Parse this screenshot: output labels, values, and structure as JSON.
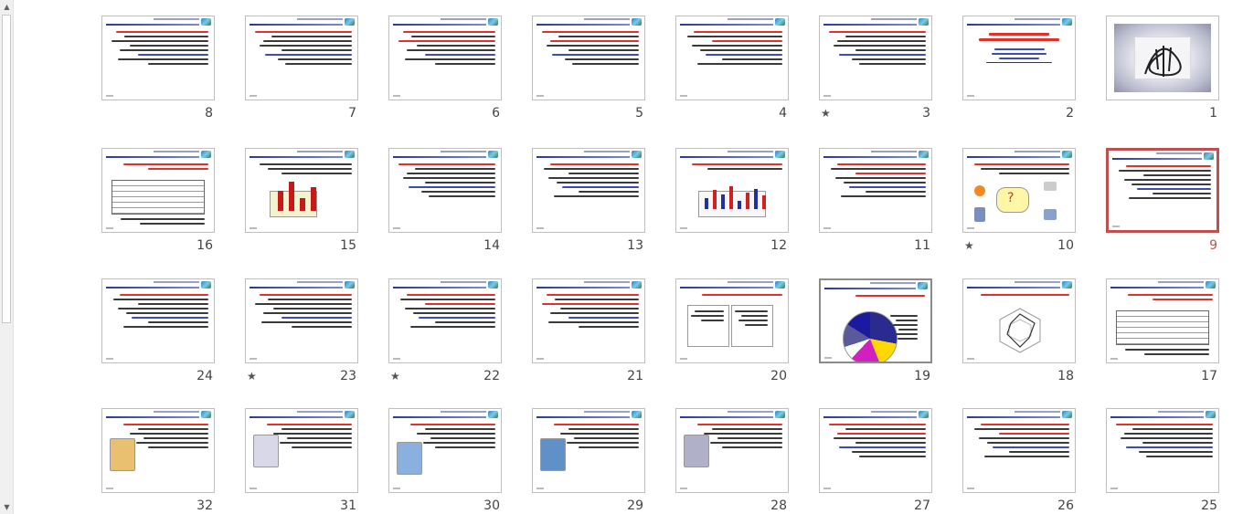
{
  "slides": [
    {
      "num": "1",
      "star": false,
      "selected": false,
      "hovered": false,
      "kind": "calligraphy"
    },
    {
      "num": "2",
      "star": false,
      "selected": false,
      "hovered": false,
      "kind": "title"
    },
    {
      "num": "3",
      "star": true,
      "selected": false,
      "hovered": false,
      "kind": "text"
    },
    {
      "num": "4",
      "star": false,
      "selected": false,
      "hovered": false,
      "kind": "text"
    },
    {
      "num": "5",
      "star": false,
      "selected": false,
      "hovered": false,
      "kind": "text"
    },
    {
      "num": "6",
      "star": false,
      "selected": false,
      "hovered": false,
      "kind": "text"
    },
    {
      "num": "7",
      "star": false,
      "selected": false,
      "hovered": false,
      "kind": "text"
    },
    {
      "num": "8",
      "star": false,
      "selected": false,
      "hovered": false,
      "kind": "text"
    },
    {
      "num": "9",
      "star": false,
      "selected": true,
      "hovered": false,
      "kind": "text"
    },
    {
      "num": "10",
      "star": true,
      "selected": false,
      "hovered": false,
      "kind": "diagram"
    },
    {
      "num": "11",
      "star": false,
      "selected": false,
      "hovered": false,
      "kind": "text"
    },
    {
      "num": "12",
      "star": false,
      "selected": false,
      "hovered": false,
      "kind": "barchart"
    },
    {
      "num": "13",
      "star": false,
      "selected": false,
      "hovered": false,
      "kind": "text"
    },
    {
      "num": "14",
      "star": false,
      "selected": false,
      "hovered": false,
      "kind": "text"
    },
    {
      "num": "15",
      "star": false,
      "selected": false,
      "hovered": false,
      "kind": "barchart3d"
    },
    {
      "num": "16",
      "star": false,
      "selected": false,
      "hovered": false,
      "kind": "table"
    },
    {
      "num": "17",
      "star": false,
      "selected": false,
      "hovered": false,
      "kind": "table"
    },
    {
      "num": "18",
      "star": false,
      "selected": false,
      "hovered": false,
      "kind": "radar"
    },
    {
      "num": "19",
      "star": false,
      "selected": false,
      "hovered": true,
      "kind": "pie"
    },
    {
      "num": "20",
      "star": false,
      "selected": false,
      "hovered": false,
      "kind": "boxes"
    },
    {
      "num": "21",
      "star": false,
      "selected": false,
      "hovered": false,
      "kind": "text"
    },
    {
      "num": "22",
      "star": true,
      "selected": false,
      "hovered": false,
      "kind": "text"
    },
    {
      "num": "23",
      "star": true,
      "selected": false,
      "hovered": false,
      "kind": "text"
    },
    {
      "num": "24",
      "star": false,
      "selected": false,
      "hovered": false,
      "kind": "text"
    },
    {
      "num": "25",
      "star": false,
      "selected": false,
      "hovered": false,
      "kind": "text"
    },
    {
      "num": "26",
      "star": false,
      "selected": false,
      "hovered": false,
      "kind": "text"
    },
    {
      "num": "27",
      "star": false,
      "selected": false,
      "hovered": false,
      "kind": "text"
    },
    {
      "num": "28",
      "star": false,
      "selected": false,
      "hovered": false,
      "kind": "textpic"
    },
    {
      "num": "29",
      "star": false,
      "selected": false,
      "hovered": false,
      "kind": "textpic"
    },
    {
      "num": "30",
      "star": false,
      "selected": false,
      "hovered": false,
      "kind": "textpic"
    },
    {
      "num": "31",
      "star": false,
      "selected": false,
      "hovered": false,
      "kind": "textpic"
    },
    {
      "num": "32",
      "star": false,
      "selected": false,
      "hovered": false,
      "kind": "textpic"
    }
  ],
  "scrollbar": {
    "up_icon": "triangle-up-icon",
    "down_icon": "triangle-down-icon"
  },
  "colors": {
    "selected_border": "#c0504d",
    "accent_red": "#e0312a",
    "accent_blue": "#3b4bb8"
  }
}
